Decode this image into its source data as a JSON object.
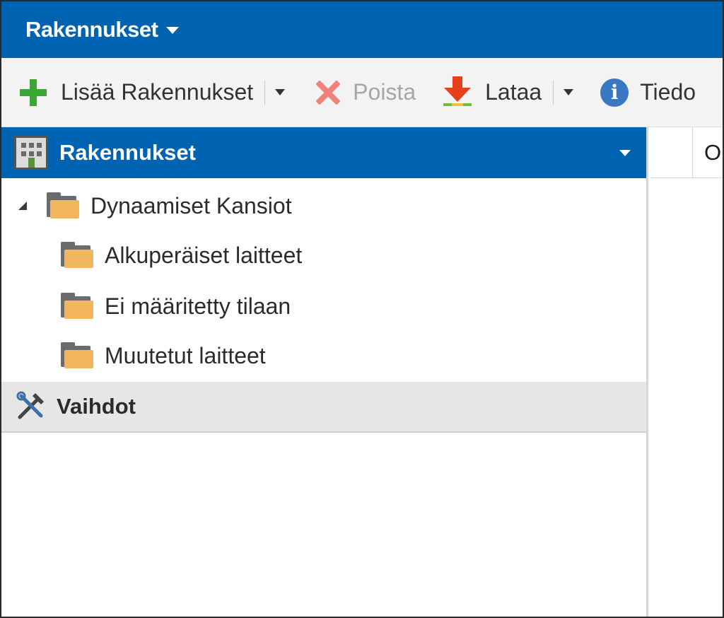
{
  "titlebar": {
    "title": "Rakennukset",
    "caret_icon": "caret-down-icon"
  },
  "toolbar": {
    "add_label": "Lisää Rakennukset",
    "delete_label": "Poista",
    "load_label": "Lataa",
    "info_label": "Tiedo",
    "icons": {
      "add": "plus-icon",
      "delete": "delete-x-icon",
      "load": "download-icon",
      "info": "info-icon"
    }
  },
  "sidebar": {
    "header": {
      "title": "Rakennukset",
      "icon": "building-icon"
    },
    "tree": {
      "root": {
        "label": "Dynaamiset Kansiot"
      },
      "children": [
        {
          "label": "Alkuperäiset laitteet"
        },
        {
          "label": "Ei määritetty tilaan"
        },
        {
          "label": "Muutetut laitteet"
        }
      ]
    },
    "section2": {
      "title": "Vaihdot",
      "icon": "tools-icon"
    }
  },
  "grid": {
    "column_header": "O"
  },
  "colors": {
    "accent": "#0063b1",
    "folder": "#f2b65f",
    "add_green": "#3aa634",
    "delete_red": "#f0827a",
    "download_red": "#e8401c"
  }
}
